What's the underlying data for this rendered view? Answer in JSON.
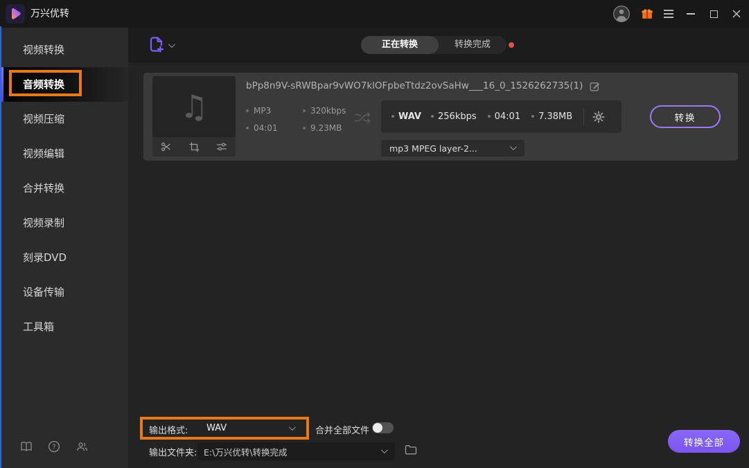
{
  "titlebar": {
    "app_title": "万兴优转"
  },
  "sidebar": {
    "items": [
      {
        "label": "视频转换"
      },
      {
        "label": "音频转换"
      },
      {
        "label": "视频压缩"
      },
      {
        "label": "视频编辑"
      },
      {
        "label": "合并转换"
      },
      {
        "label": "视频录制"
      },
      {
        "label": "刻录DVD"
      },
      {
        "label": "设备传输"
      },
      {
        "label": "工具箱"
      }
    ],
    "active_index": 1
  },
  "tabs": {
    "converting": "正在转换",
    "finished": "转换完成"
  },
  "file_card": {
    "filename": "bPp8n9V-sRWBpar9vWO7klOFpbeTtdz2ovSaHw___16_0_1526262735(1)",
    "source": {
      "format": "MP3",
      "bitrate": "320kbps",
      "duration": "04:01",
      "size": "9.23MB"
    },
    "target": {
      "format": "WAV",
      "bitrate": "256kbps",
      "duration": "04:01",
      "size": "7.38MB"
    },
    "format_select": "mp3 MPEG layer-2...",
    "convert_button": "转换"
  },
  "footer": {
    "output_format_label": "输出格式:",
    "output_format_value": "WAV",
    "merge_all_label": "合并全部文件",
    "merge_all_on": false,
    "output_folder_label": "输出文件夹:",
    "output_folder_value": "E:\\万兴优转\\转换完成",
    "convert_all_button": "转换全部"
  },
  "colors": {
    "accent_purple": "#7d5ef5",
    "button_purple": "#8a68f8",
    "annotation_orange": "#e8791a",
    "badge_red": "#df4f4f",
    "gift_orange": "#f2711c"
  }
}
